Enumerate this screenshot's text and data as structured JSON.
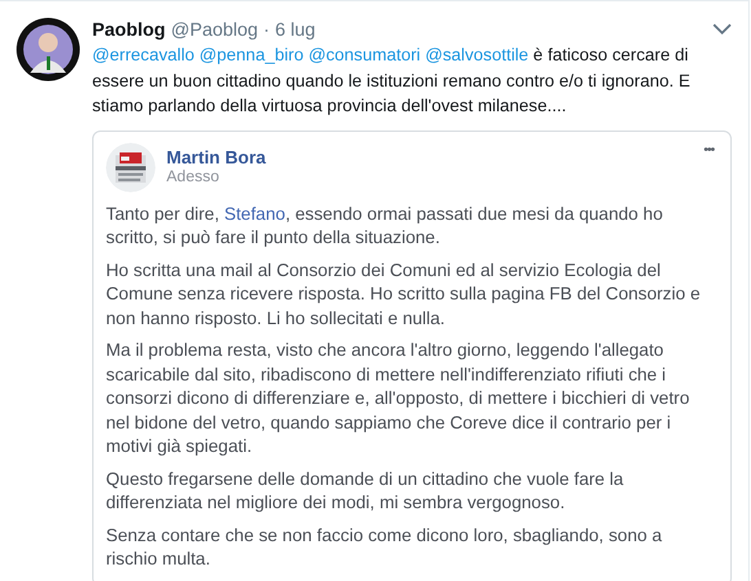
{
  "tweet": {
    "name": "Paoblog",
    "handle": "@Paoblog",
    "separator": "·",
    "time": "6 lug",
    "text": [
      {
        "kind": "mention",
        "text": "@errecavallo"
      },
      {
        "kind": "mention",
        "text": "@penna_biro"
      },
      {
        "kind": "mention",
        "text": "@consumatori"
      },
      {
        "kind": "mention",
        "text": "@salvosottile"
      },
      {
        "kind": "text",
        "text": " è faticoso cercare di essere un buon cittadino quando le istituzioni remano contro e/o ti ignorano. E stiamo parlando della virtuosa provincia dell'ovest milanese...."
      }
    ],
    "quote": {
      "name": "Martin Bora",
      "time": "Adesso",
      "more": "•••",
      "paragraphs": [
        [
          {
            "kind": "text",
            "text": "Tanto per dire, "
          },
          {
            "kind": "mention",
            "text": "Stefano"
          },
          {
            "kind": "text",
            "text": ", essendo ormai passati due mesi da quando ho scritto, si può fare il punto della situazione."
          }
        ],
        [
          {
            "kind": "text",
            "text": "Ho scritta una mail al Consorzio dei Comuni ed al servizio Ecologia del Comune senza ricevere risposta. Ho scritto sulla pagina FB del Consorzio e non hanno risposto. Li ho sollecitati e nulla."
          }
        ],
        [
          {
            "kind": "text",
            "text": "Ma il problema resta, visto che ancora l'altro giorno, leggendo l'allegato scaricabile dal sito, ribadiscono di mettere nell'indifferenziato rifiuti che i consorzi dicono di differenziare e, all'opposto, di mettere i bicchieri di vetro nel bidone del vetro, quando sappiamo che Coreve dice il contrario per i motivi già spiegati."
          }
        ],
        [
          {
            "kind": "text",
            "text": "Questo fregarsene delle domande di un cittadino che vuole fare la differenziata nel migliore dei modi, mi sembra vergognoso."
          }
        ],
        [
          {
            "kind": "text",
            "text": "Senza contare che se non faccio come dicono loro, sbagliando, sono a rischio multa."
          }
        ]
      ]
    }
  }
}
